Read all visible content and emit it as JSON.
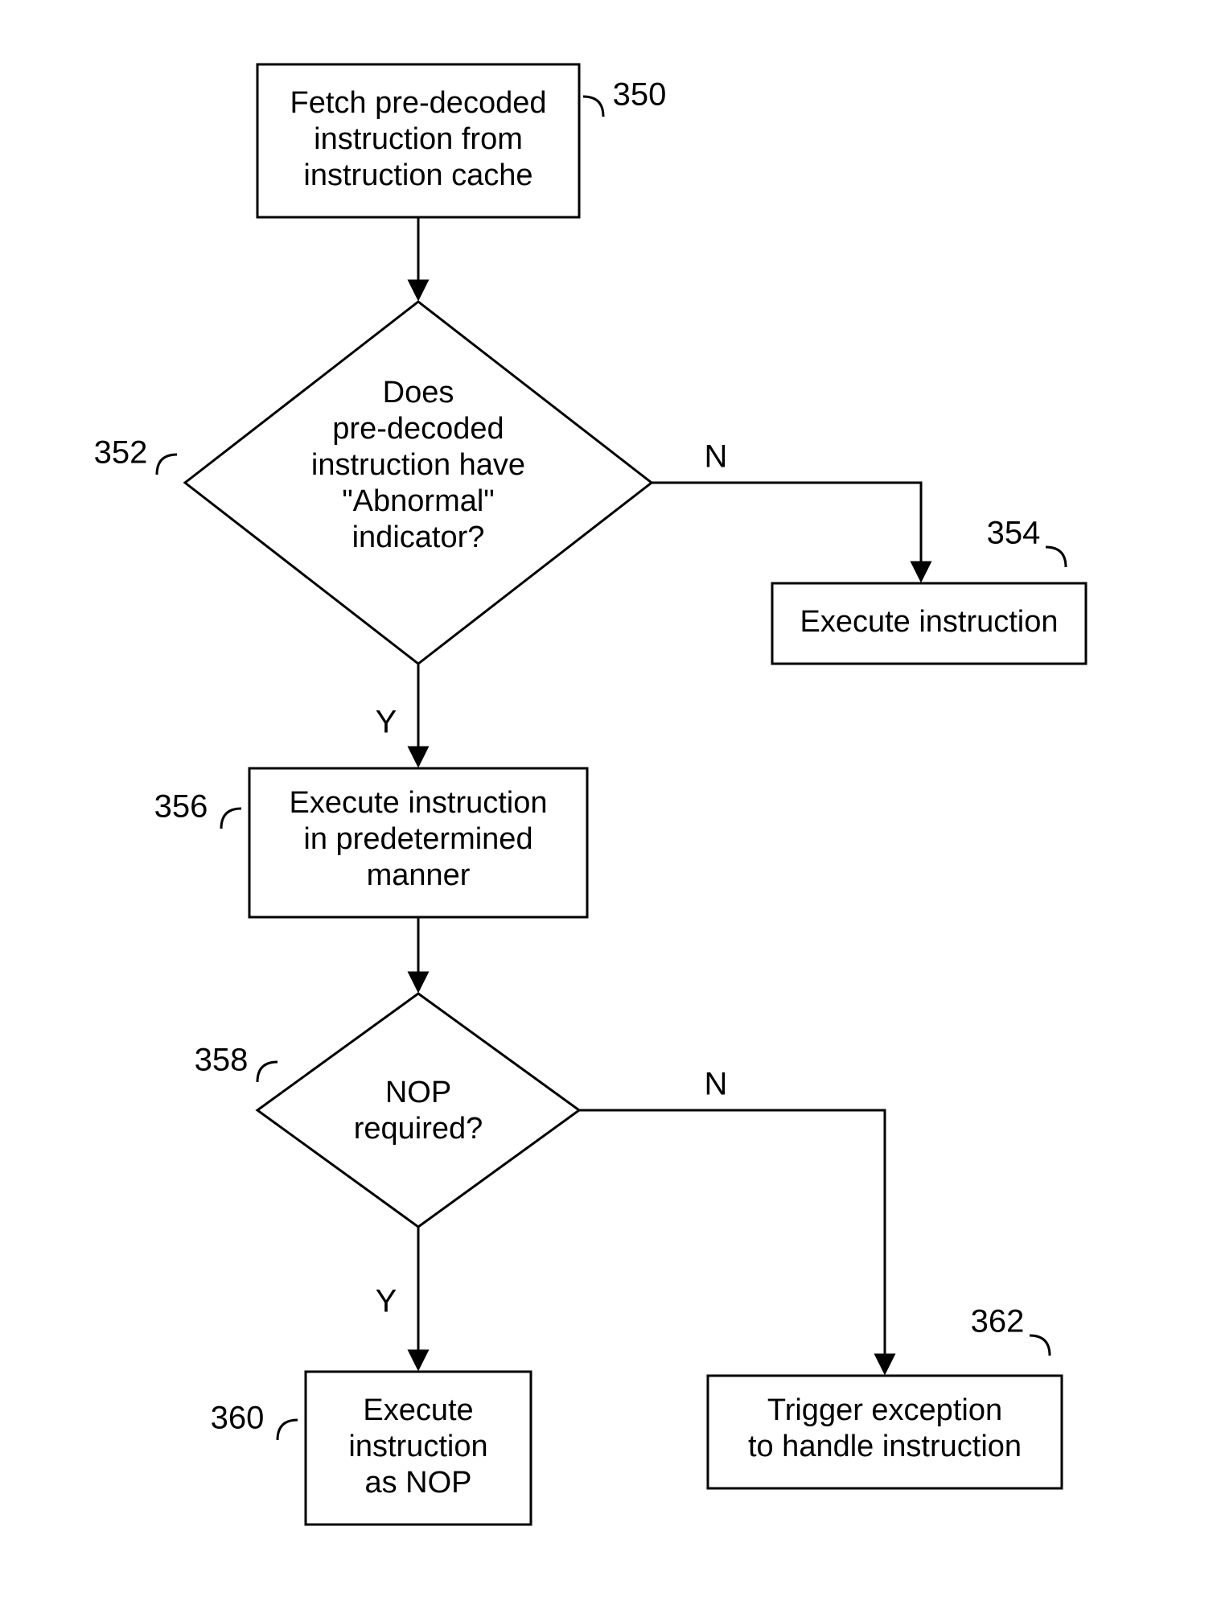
{
  "chart_data": {
    "type": "flowchart",
    "nodes": [
      {
        "id": "350",
        "ref": "350",
        "shape": "process",
        "text": "Fetch pre-decoded instruction from instruction cache"
      },
      {
        "id": "352",
        "ref": "352",
        "shape": "decision",
        "text": "Does pre-decoded instruction have \"Abnormal\" indicator?"
      },
      {
        "id": "354",
        "ref": "354",
        "shape": "process",
        "text": "Execute instruction"
      },
      {
        "id": "356",
        "ref": "356",
        "shape": "process",
        "text": "Execute instruction in predetermined manner"
      },
      {
        "id": "358",
        "ref": "358",
        "shape": "decision",
        "text": "NOP required?"
      },
      {
        "id": "360",
        "ref": "360",
        "shape": "process",
        "text": "Execute instruction as NOP"
      },
      {
        "id": "362",
        "ref": "362",
        "shape": "process",
        "text": "Trigger exception to handle instruction"
      }
    ],
    "edges": [
      {
        "from": "350",
        "to": "352",
        "label": ""
      },
      {
        "from": "352",
        "to": "354",
        "label": "N"
      },
      {
        "from": "352",
        "to": "356",
        "label": "Y"
      },
      {
        "from": "356",
        "to": "358",
        "label": ""
      },
      {
        "from": "358",
        "to": "360",
        "label": "Y"
      },
      {
        "from": "358",
        "to": "362",
        "label": "N"
      }
    ]
  },
  "labels": {
    "Y": "Y",
    "N": "N"
  },
  "refs": {
    "n350": "350",
    "n352": "352",
    "n354": "354",
    "n356": "356",
    "n358": "358",
    "n360": "360",
    "n362": "362"
  },
  "text": {
    "n350_l1": "Fetch pre-decoded",
    "n350_l2": "instruction from",
    "n350_l3": "instruction cache",
    "n352_l1": "Does",
    "n352_l2": "pre-decoded",
    "n352_l3": "instruction have",
    "n352_l4": "\"Abnormal\"",
    "n352_l5": "indicator?",
    "n354_l1": "Execute instruction",
    "n356_l1": "Execute instruction",
    "n356_l2": "in predetermined",
    "n356_l3": "manner",
    "n358_l1": "NOP",
    "n358_l2": "required?",
    "n360_l1": "Execute",
    "n360_l2": "instruction",
    "n360_l3": "as NOP",
    "n362_l1": "Trigger exception",
    "n362_l2": "to handle instruction"
  }
}
